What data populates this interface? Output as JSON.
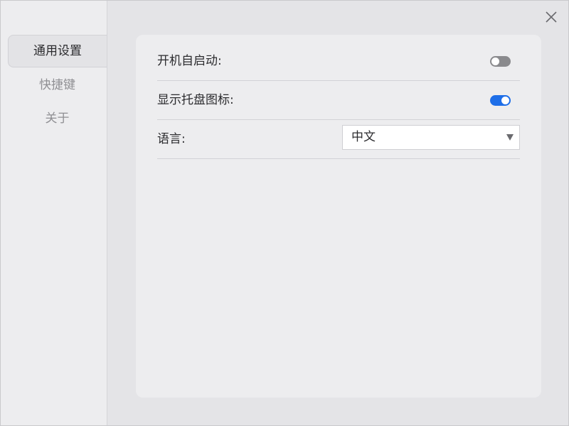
{
  "sidebar": {
    "items": [
      {
        "label": "通用设置"
      },
      {
        "label": "快捷键"
      },
      {
        "label": "关于"
      }
    ]
  },
  "settings": {
    "autostart": {
      "label": "开机自启动:",
      "enabled": false
    },
    "tray_icon": {
      "label": "显示托盘图标:",
      "enabled": true
    },
    "language": {
      "label": "语言:",
      "value": "中文"
    }
  },
  "colors": {
    "accent": "#1e6ee8",
    "toggle_off": "#8a8a8d"
  },
  "icons": {
    "close": "close-icon",
    "dropdown": "chevron-down-icon"
  }
}
